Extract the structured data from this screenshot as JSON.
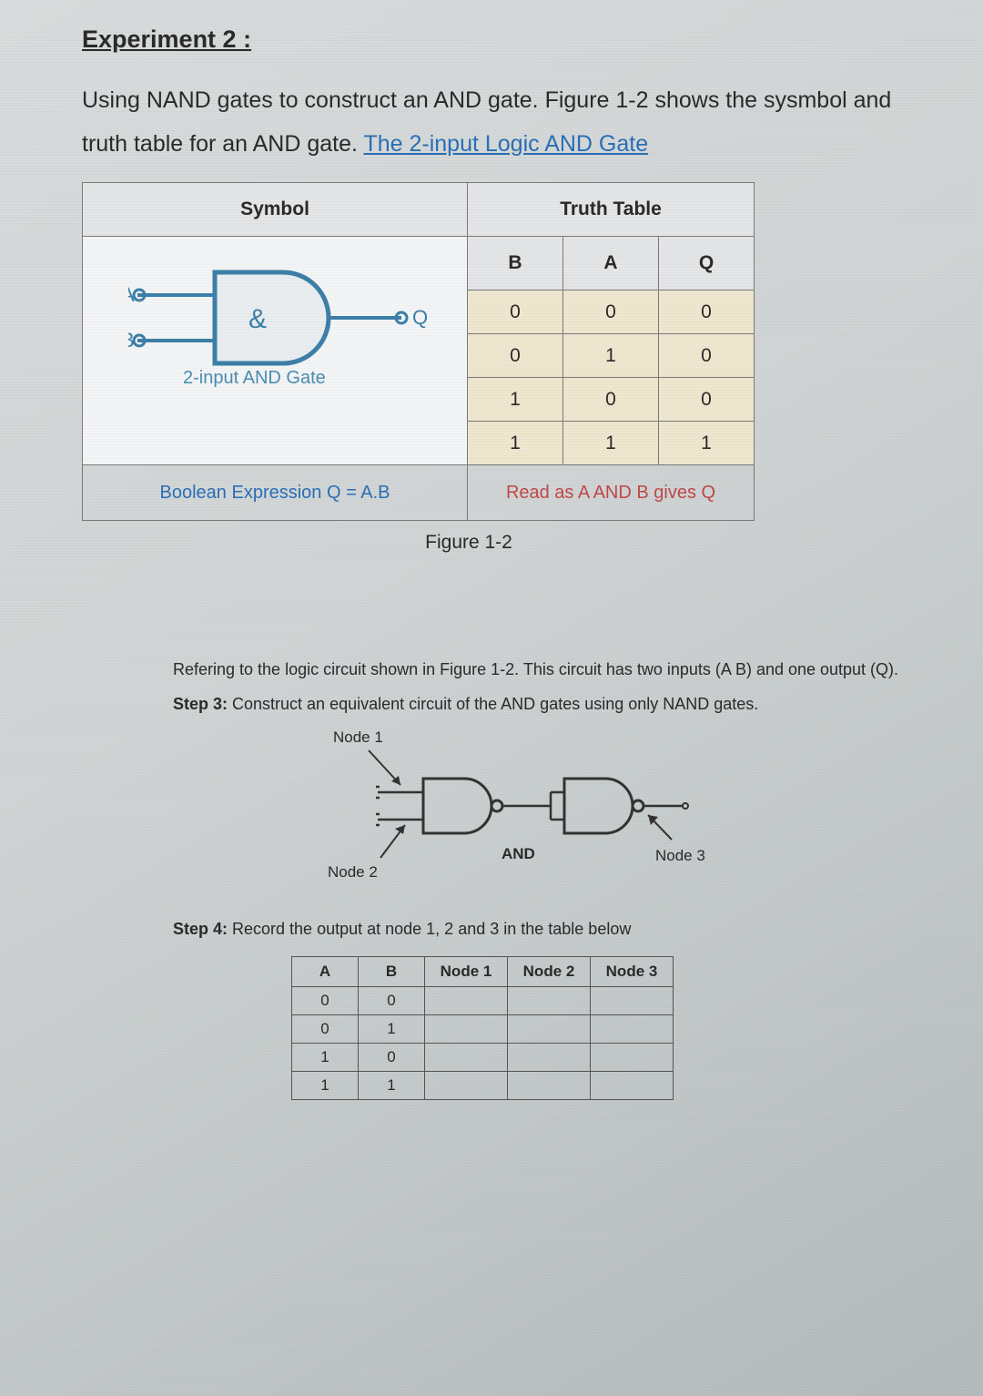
{
  "heading": "Experiment 2 :",
  "intro_before_link": "Using NAND gates to construct an AND gate. Figure 1-2 shows the sysmbol and truth table for an AND gate. ",
  "link_text": "The 2-input Logic AND Gate",
  "table": {
    "symbol_header": "Symbol",
    "truth_header": "Truth Table",
    "cols": [
      "B",
      "A",
      "Q"
    ],
    "rows": [
      [
        "0",
        "0",
        "0"
      ],
      [
        "0",
        "1",
        "0"
      ],
      [
        "1",
        "0",
        "0"
      ],
      [
        "1",
        "1",
        "1"
      ]
    ],
    "gate_caption": "2-input AND Gate",
    "gate_input_a": "A",
    "gate_input_b": "B",
    "gate_amp": "&",
    "gate_output": "Q",
    "footer_left": "Boolean Expression Q = A.B",
    "footer_right": "Read as A AND B gives Q"
  },
  "figure_caption": "Figure 1-2",
  "lower": {
    "refer": "Refering to the logic circuit shown in Figure 1-2. This circuit has two inputs (A B) and one output (Q).",
    "step3_label": "Step 3:",
    "step3_text": " Construct an equivalent circuit of the AND gates using only NAND gates.",
    "node1": "Node 1",
    "node2": "Node 2",
    "node3": "Node 3",
    "and_label": "AND",
    "step4_label": "Step 4:",
    "step4_text": " Record the output at node 1, 2 and 3 in the table below",
    "nodes_table": {
      "headers": [
        "A",
        "B",
        "Node 1",
        "Node 2",
        "Node 3"
      ],
      "rows": [
        [
          "0",
          "0",
          "",
          "",
          ""
        ],
        [
          "0",
          "1",
          "",
          "",
          ""
        ],
        [
          "1",
          "0",
          "",
          "",
          ""
        ],
        [
          "1",
          "1",
          "",
          "",
          ""
        ]
      ]
    }
  }
}
